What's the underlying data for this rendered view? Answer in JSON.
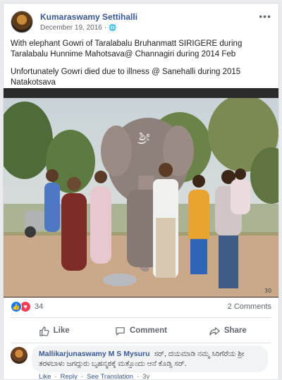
{
  "post": {
    "author": "Kumaraswamy Settihalli",
    "date": "December 19, 2016",
    "privacy_icon": "globe-icon",
    "more_label": "•••",
    "text": [
      "With elephant Gowri of Taralabalu Bruhanmatt SIRIGERE during Taralabalu Hunnime Mahotsava@ Channagiri during 2014 Feb",
      "Unfortunately Gowri died due to illness @ Sanehalli during 2015 Natakotsava"
    ],
    "photo_watermark": "30"
  },
  "stats": {
    "reaction_count": "34",
    "comments_count": "2 Comments",
    "reaction_icons": [
      "like-icon",
      "love-icon"
    ]
  },
  "actions": {
    "like": "Like",
    "comment": "Comment",
    "share": "Share"
  },
  "comment": {
    "author": "Mallikarjunaswamy M S Mysuru",
    "text": "ಸರ್, ದಯಮಾಡಿ ನಮ್ಮ ಸಿರಿಗೆರೆಯ ಶ್ರೀ ತರಳಬಾಳು ಜಗದ್ಗುರು ಬೃಹನ್ಮಠಕ್ಕೆ ಮತ್ತೊಂದು ಆನೆ ಕೊಡ್ಸಿ ಸರ್.",
    "like": "Like",
    "reply": "Reply",
    "see_translation": "See Translation",
    "time": "3y",
    "sep": "·"
  },
  "colors": {
    "link_blue": "#385898",
    "like_blue": "#1877f2",
    "love_red": "#f33e58",
    "muted": "#606770"
  }
}
